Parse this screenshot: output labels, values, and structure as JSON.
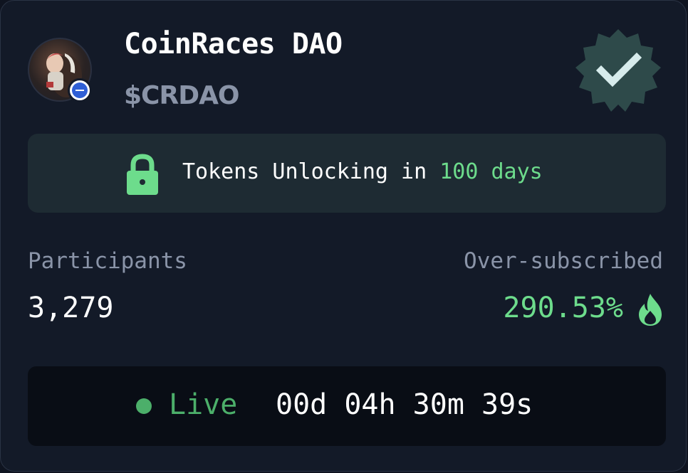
{
  "project": {
    "name": "CoinRaces DAO",
    "ticker": "$CRDAO",
    "avatar_icon": "project-avatar",
    "chain_icon": "chain-badge-icon",
    "verified_icon": "verified-badge-icon"
  },
  "unlock": {
    "prefix": "Tokens Unlocking in ",
    "days": "100 days",
    "icon": "lock-icon"
  },
  "stats": {
    "participants_label": "Participants",
    "participants_value": "3,279",
    "oversub_label": "Over-subscribed",
    "oversub_value": "290.53%",
    "oversub_icon": "flame-icon"
  },
  "status": {
    "label": "Live",
    "countdown": "00d 04h 30m 39s"
  },
  "colors": {
    "card_bg": "#131a28",
    "accent_green": "#6ddc8c",
    "live_green": "#4caf6a",
    "muted_text": "#8a94a8",
    "verified_badge": "#2e4a4a"
  }
}
